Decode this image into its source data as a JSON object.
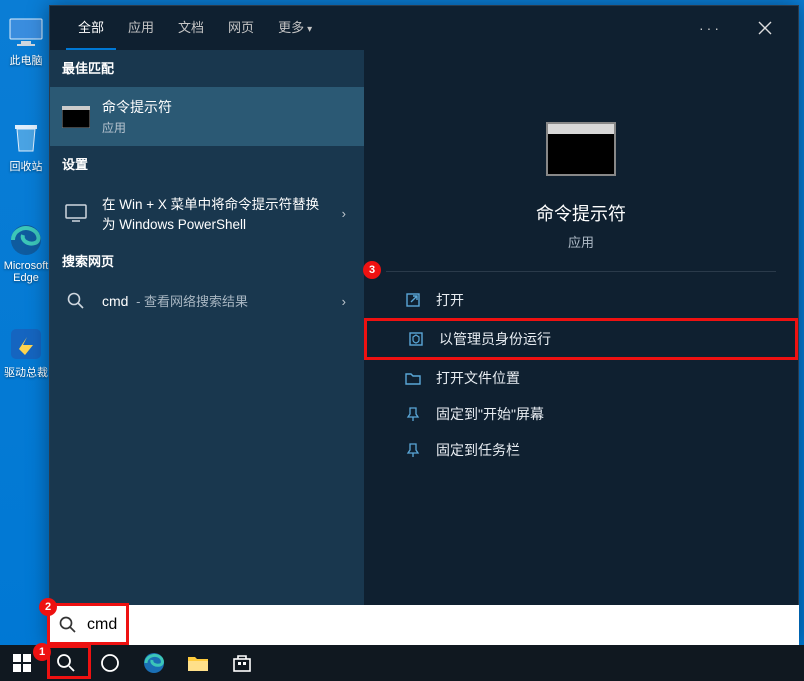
{
  "desktop": {
    "icons": [
      {
        "name": "此电脑"
      },
      {
        "name": "回收站"
      },
      {
        "name": "Microsoft Edge"
      },
      {
        "name": "驱动总裁"
      }
    ]
  },
  "tabs": {
    "items": [
      "全部",
      "应用",
      "文档",
      "网页",
      "更多"
    ]
  },
  "left": {
    "best_match_header": "最佳匹配",
    "best_result": {
      "title": "命令提示符",
      "subtitle": "应用"
    },
    "settings_header": "设置",
    "setting_item": {
      "title": "在 Win + X 菜单中将命令提示符替换为 Windows PowerShell"
    },
    "search_web_header": "搜索网页",
    "web_item": {
      "query": "cmd",
      "suffix": " - 查看网络搜索结果"
    }
  },
  "preview": {
    "title": "命令提示符",
    "subtitle": "应用",
    "actions": [
      {
        "label": "打开"
      },
      {
        "label": "以管理员身份运行"
      },
      {
        "label": "打开文件位置"
      },
      {
        "label": "固定到\"开始\"屏幕"
      },
      {
        "label": "固定到任务栏"
      }
    ]
  },
  "search": {
    "value": "cmd"
  },
  "annotations": {
    "b1": "1",
    "b2": "2",
    "b3": "3"
  }
}
